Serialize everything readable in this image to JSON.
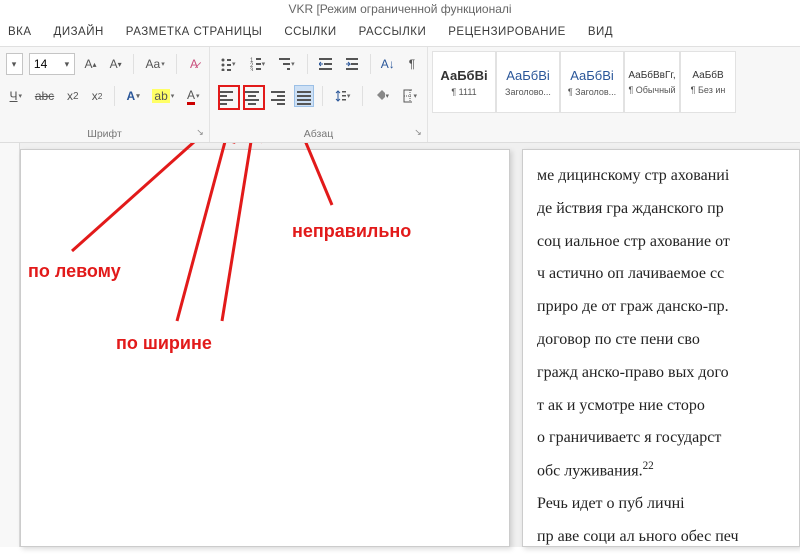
{
  "title": "VKR [Режим ограниченной функционалі",
  "tabs": [
    "ВКА",
    "ДИЗАЙН",
    "РАЗМЕТКА СТРАНИЦЫ",
    "ССЫЛКИ",
    "РАССЫЛКИ",
    "РЕЦЕНЗИРОВАНИЕ",
    "ВИД"
  ],
  "font": {
    "size": "14",
    "group_label": "Шрифт"
  },
  "paragraph": {
    "group_label": "Абзац"
  },
  "styles": [
    {
      "sample": "АаБбВі",
      "name": "¶ 1111",
      "cls": "normal"
    },
    {
      "sample": "АаБбВі",
      "name": "Заголово..."
    },
    {
      "sample": "АаБбВі",
      "name": "¶ Заголов..."
    },
    {
      "sample": "АаБбВвГг,",
      "name": "¶ Обычный",
      "cls": "small"
    },
    {
      "sample": "АаБбВ",
      "name": "¶ Без ин",
      "cls": "small"
    }
  ],
  "annotations": {
    "left": "по левому",
    "justify": "по ширине",
    "wrong": "неправильно"
  },
  "doc_lines": [
    "ме дицинскому   стр ахованиі",
    "де йствия  гра жданского  пр",
    "соц иальное  стр ахование  от",
    "ч астично   оп лачиваемое   сс",
    "приро де  от  граж данско-пр.",
    "договор    по    сте пени    сво",
    "гражд анско-право вых   дого",
    "т ак    и   усмотре ние   сторо",
    "о граничиваетс я     государст",
    "обс луживания."
  ],
  "doc_footnote": "22",
  "doc_tail": "          Речь  идет  о  пуб личні\nпр аве  соци ал ьного  обес печ"
}
